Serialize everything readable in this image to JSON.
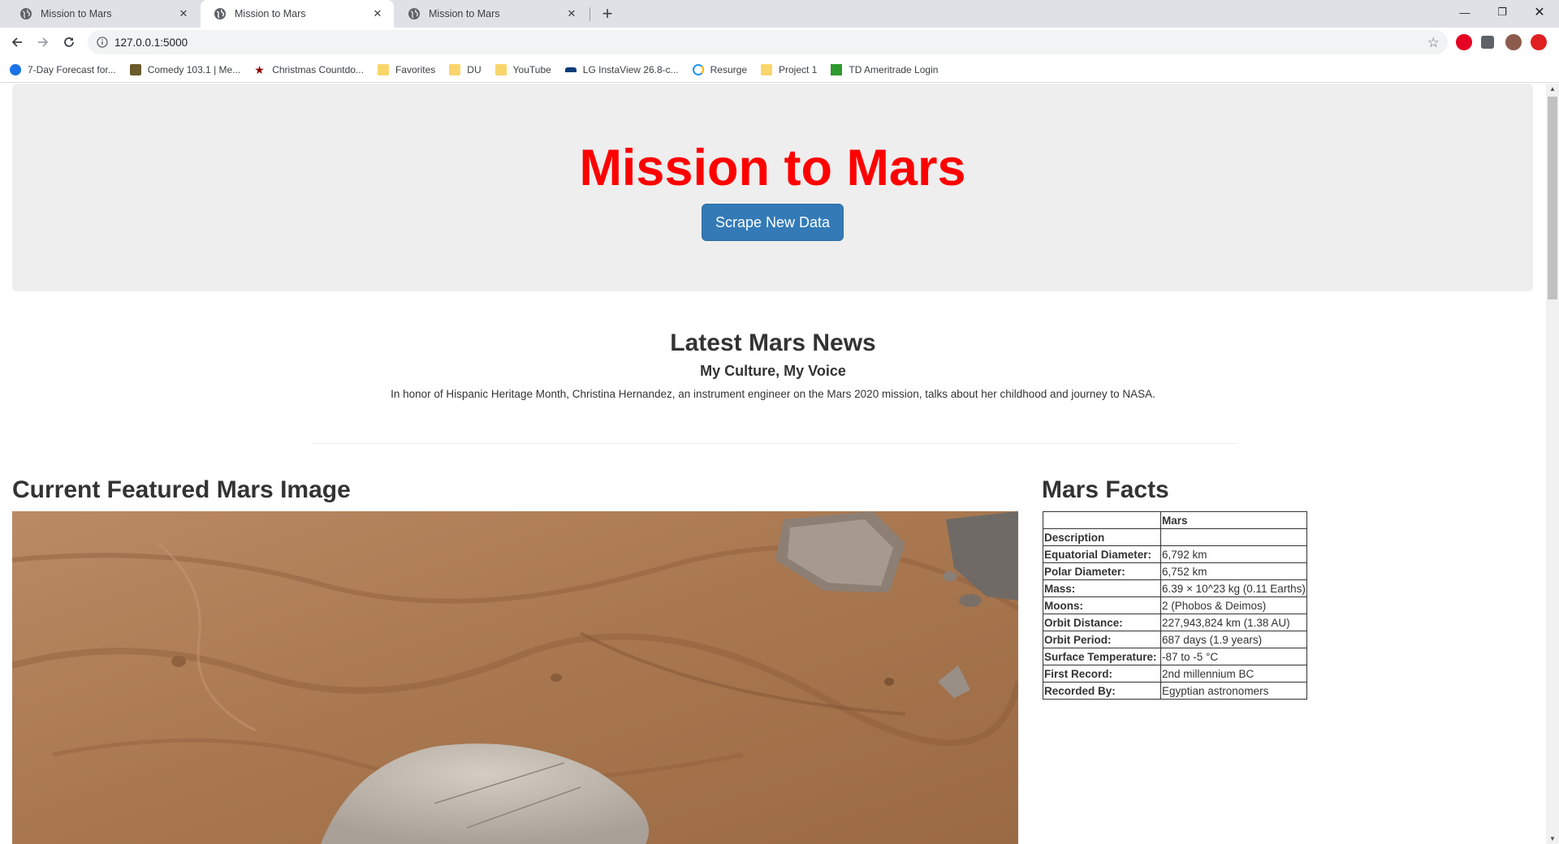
{
  "browser": {
    "tabs": [
      {
        "title": "Mission to Mars"
      },
      {
        "title": "Mission to Mars"
      },
      {
        "title": "Mission to Mars"
      }
    ],
    "url": "127.0.0.1:5000",
    "bookmarks": [
      {
        "label": "7-Day Forecast for...",
        "icon": "weather-icon"
      },
      {
        "label": "Comedy 103.1 | Me...",
        "icon": "radio-icon"
      },
      {
        "label": "Christmas Countdo...",
        "icon": "star-icon"
      },
      {
        "label": "Favorites",
        "icon": "folder-icon"
      },
      {
        "label": "DU",
        "icon": "folder-icon"
      },
      {
        "label": "YouTube",
        "icon": "folder-icon"
      },
      {
        "label": "LG InstaView 26.8-c...",
        "icon": "lg-icon"
      },
      {
        "label": "Resurge",
        "icon": "resurge-icon"
      },
      {
        "label": "Project 1",
        "icon": "folder-icon"
      },
      {
        "label": "TD Ameritrade Login",
        "icon": "td-icon"
      }
    ]
  },
  "page": {
    "title": "Mission to Mars",
    "scrape_button": "Scrape New Data",
    "news": {
      "heading": "Latest Mars News",
      "headline": "My Culture, My Voice",
      "teaser": "In honor of Hispanic Heritage Month, Christina Hernandez, an instrument engineer on the Mars 2020 mission, talks about her childhood and journey to NASA."
    },
    "featured_heading": "Current Featured Mars Image",
    "facts": {
      "heading": "Mars Facts",
      "column_header": "Mars",
      "rows": [
        {
          "label": "Description",
          "value": ""
        },
        {
          "label": "Equatorial Diameter:",
          "value": "6,792 km"
        },
        {
          "label": "Polar Diameter:",
          "value": "6,752 km"
        },
        {
          "label": "Mass:",
          "value": "6.39 × 10^23 kg (0.11 Earths)"
        },
        {
          "label": "Moons:",
          "value": "2 (Phobos & Deimos)"
        },
        {
          "label": "Orbit Distance:",
          "value": "227,943,824 km (1.38 AU)"
        },
        {
          "label": "Orbit Period:",
          "value": "687 days (1.9 years)"
        },
        {
          "label": "Surface Temperature:",
          "value": "-87 to -5 °C"
        },
        {
          "label": "First Record:",
          "value": "2nd millennium BC"
        },
        {
          "label": "Recorded By:",
          "value": "Egyptian astronomers"
        }
      ]
    }
  },
  "colors": {
    "title_red": "#ff0000",
    "button_blue": "#337ab7",
    "jumbotron_bg": "#eeeeee"
  }
}
